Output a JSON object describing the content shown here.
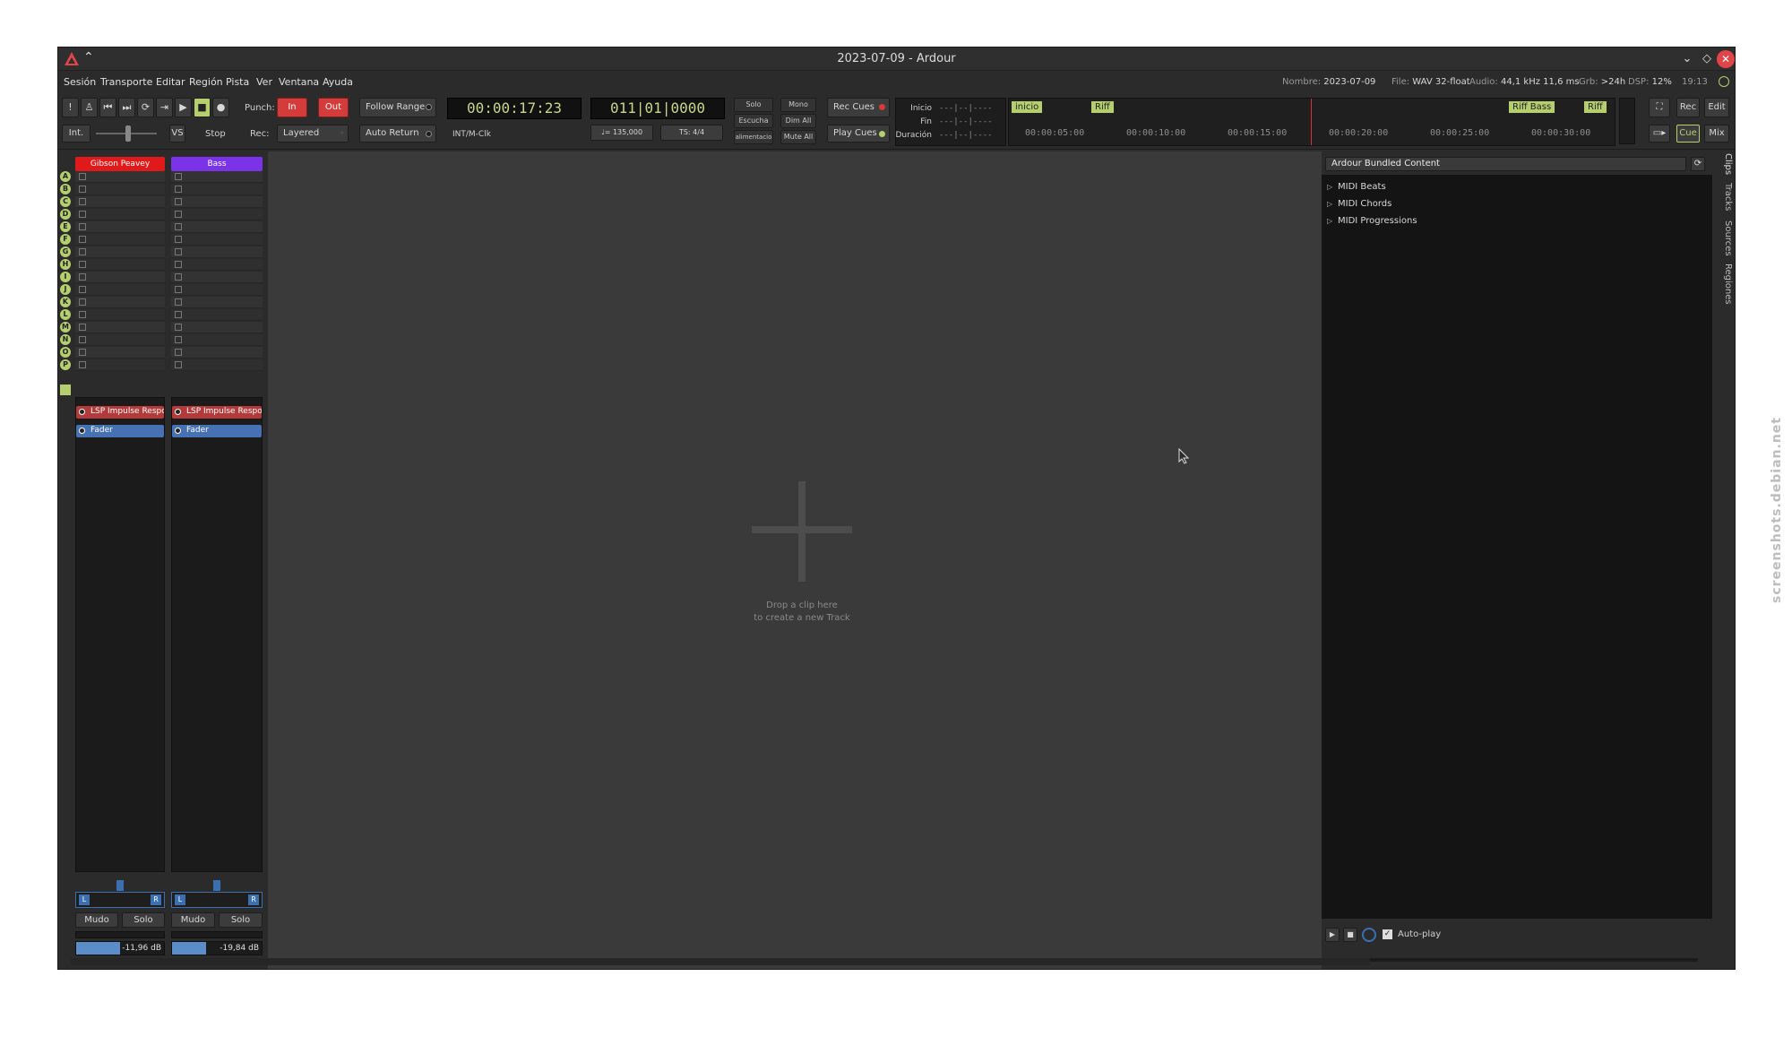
{
  "window": {
    "title": "2023-07-09 - Ardour"
  },
  "menu": [
    "Sesión",
    "Transporte",
    "Editar",
    "Región",
    "Pista",
    "Ver",
    "Ventana",
    "Ayuda"
  ],
  "status": {
    "name_label": "Nombre:",
    "name_value": "2023-07-09",
    "file_label": "File:",
    "file_value": "WAV 32-float",
    "audio_label": "Audio:",
    "audio_value": "44,1 kHz 11,6 ms",
    "grb_label": "Grb:",
    "grb_value": ">24h",
    "dsp_label": "DSP:",
    "dsp_value": "12%",
    "time": "19:13"
  },
  "transport": {
    "int_label": "Int.",
    "vs_label": "VS",
    "stop_label": "Stop",
    "punch_label": "Punch:",
    "punch_in": "In",
    "punch_out": "Out",
    "rec_label": "Rec:",
    "rec_mode": "Layered",
    "follow_range": "Follow Range",
    "auto_return": "Auto Return",
    "sync_source": "INT/M-Clk",
    "primary_clock": "00:00:17:23",
    "secondary_clock": "011|01|0000",
    "tempo": "♩= 135,000",
    "meter": "TS: 4/4",
    "monitor": {
      "solo": "Solo",
      "escucha": "Escucha",
      "alimentacion": "alimentacio",
      "mono": "Mono",
      "dim_all": "Dim All",
      "mute_all": "Mute All"
    },
    "rec_cues": "Rec Cues",
    "play_cues": "Play Cues"
  },
  "locations": {
    "inicio_label": "Inicio",
    "fin_label": "Fin",
    "duracion_label": "Duración",
    "inicio_value": "---|--|----",
    "fin_value": "---|--|----",
    "duracion_value": "---|--|----"
  },
  "mini_timeline": {
    "markers": [
      "inicio",
      "Riff",
      "Riff Bass",
      "Riff"
    ],
    "ticks": [
      "00:00:05:00",
      "00:00:10:00",
      "00:00:15:00",
      "00:00:20:00",
      "00:00:25:00",
      "00:00:30:00"
    ]
  },
  "view_buttons": {
    "rec": "Rec",
    "edit": "Edit",
    "cue": "Cue",
    "mix": "Mix"
  },
  "cue_letters": [
    "A",
    "B",
    "C",
    "D",
    "E",
    "F",
    "G",
    "H",
    "I",
    "J",
    "K",
    "L",
    "M",
    "N",
    "O",
    "P"
  ],
  "tracks": [
    {
      "name": "Gibson Peavey",
      "color": "#e01a1a",
      "plugin": "LSP Impulse Respon",
      "fader_label": "Fader",
      "mute": "Mudo",
      "solo": "Solo",
      "gain_db": "-11,96 dB",
      "gain_fraction": 0.5
    },
    {
      "name": "Bass",
      "color": "#7a33e6",
      "plugin": "LSP Impulse Respon",
      "fader_label": "Fader",
      "mute": "Mudo",
      "solo": "Solo",
      "gain_db": "-19,84 dB",
      "gain_fraction": 0.38
    }
  ],
  "panner_labels": {
    "left": "L",
    "right": "R"
  },
  "canvas": {
    "drop_line1": "Drop a clip here",
    "drop_line2": "to create a new Track"
  },
  "clips_panel": {
    "source": "Ardour Bundled Content",
    "items": [
      "MIDI Beats",
      "MIDI Chords",
      "MIDI Progressions"
    ],
    "autoplay_label": "Auto-play"
  },
  "side_tabs": [
    "Clips",
    "Tracks",
    "Sources",
    "Regiones"
  ],
  "watermark": "screenshots.debian.net"
}
